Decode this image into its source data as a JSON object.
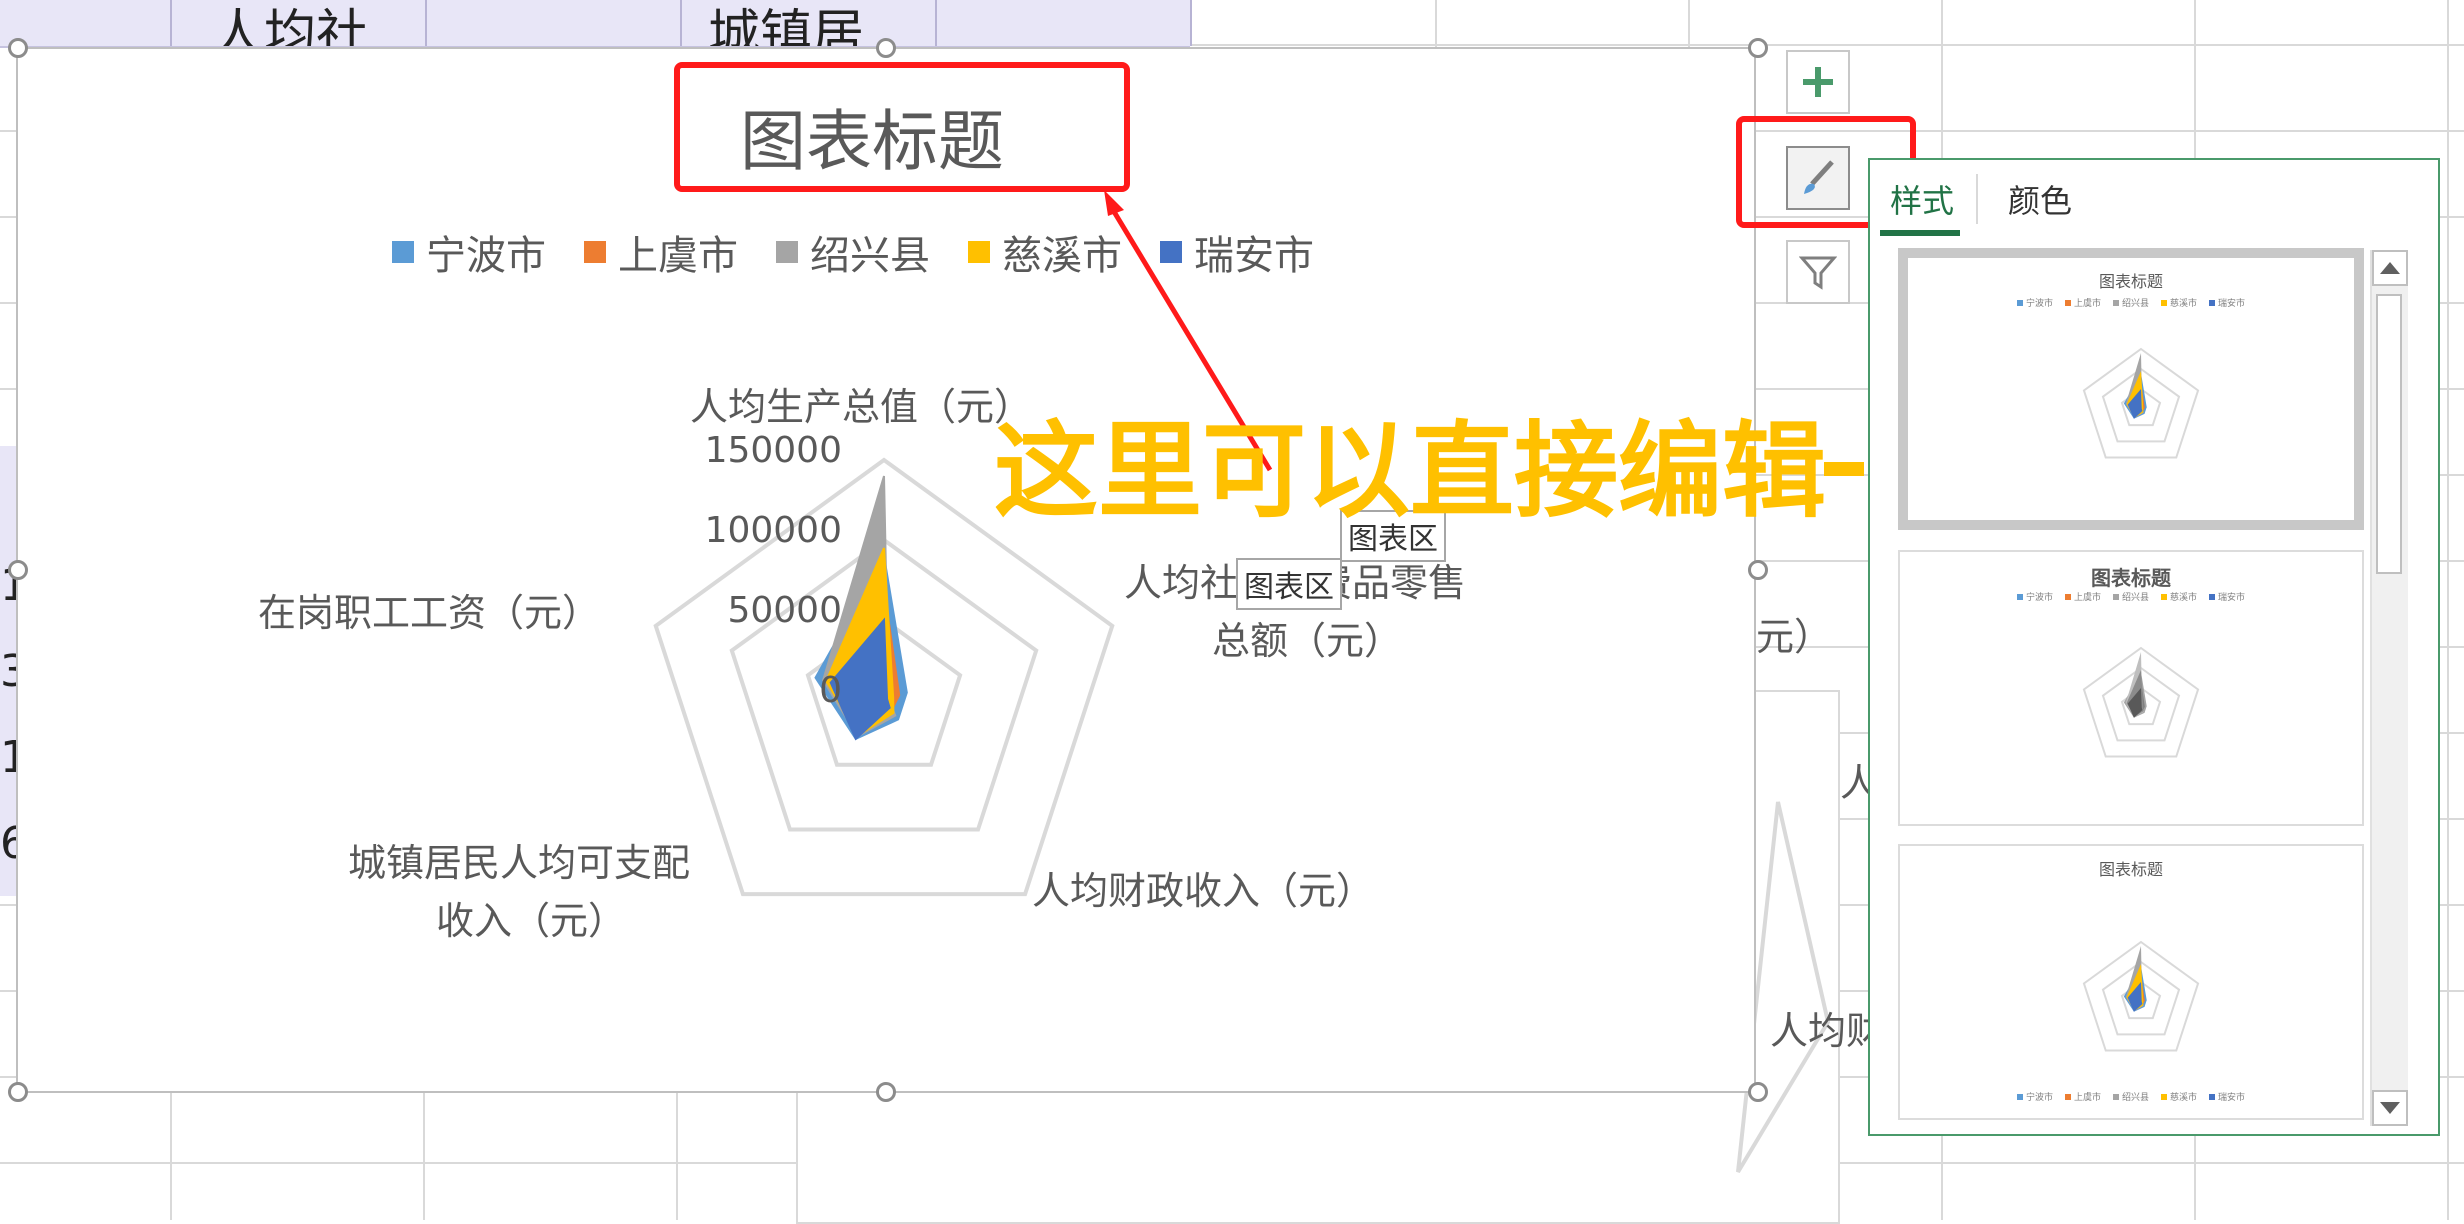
{
  "spreadsheet": {
    "header_cells": [
      "人均社",
      "",
      "城镇居",
      ""
    ],
    "left_column_chars": [
      "1",
      "3",
      "1",
      "6"
    ]
  },
  "ghost_chart": {
    "labels": [
      "元）",
      "人",
      "人均财"
    ]
  },
  "chart": {
    "title": "图表标题",
    "legend": [
      {
        "name": "宁波市",
        "color": "#5b9bd5"
      },
      {
        "name": "上虞市",
        "color": "#ed7d31"
      },
      {
        "name": "绍兴县",
        "color": "#a5a5a5"
      },
      {
        "name": "慈溪市",
        "color": "#ffc000"
      },
      {
        "name": "瑞安市",
        "color": "#4472c4"
      }
    ],
    "axis_labels": {
      "top": "人均生产总值（元）",
      "right_line1": "人均社会消费品零售",
      "right_line2": "总额（元）",
      "bottom_right": "人均财政收入（元）",
      "bottom_left_line1": "城镇居民人均可支配",
      "bottom_left_line2": "收入（元）",
      "left": "在岗职工工资（元）"
    },
    "ticks": [
      "150000",
      "100000",
      "50000",
      "0"
    ],
    "tooltips": [
      "图表区",
      "图表区"
    ]
  },
  "chart_data": {
    "type": "radar",
    "title": "图表标题",
    "categories": [
      "人均生产总值（元）",
      "人均社会消费品零售总额（元）",
      "人均财政收入（元）",
      "城镇居民人均可支配收入（元）",
      "在岗职工工资（元）"
    ],
    "rlim": [
      0,
      150000
    ],
    "ticks": [
      0,
      50000,
      100000,
      150000
    ],
    "series": [
      {
        "name": "宁波市",
        "color": "#5b9bd5",
        "values": [
          90000,
          15000,
          15000,
          30000,
          45000
        ]
      },
      {
        "name": "上虞市",
        "color": "#ed7d31",
        "values": [
          70000,
          10000,
          8000,
          25000,
          35000
        ]
      },
      {
        "name": "绍兴县",
        "color": "#a5a5a5",
        "values": [
          140000,
          3000,
          12000,
          28000,
          40000
        ]
      },
      {
        "name": "慈溪市",
        "color": "#ffc000",
        "values": [
          95000,
          6000,
          10000,
          27000,
          38000
        ]
      },
      {
        "name": "瑞安市",
        "color": "#4472c4",
        "values": [
          50000,
          2000,
          6000,
          30000,
          35000
        ]
      }
    ]
  },
  "annotation": {
    "text": "这里可以直接编辑"
  },
  "side_buttons": [
    {
      "name": "add-chart-element",
      "icon": "plus-icon"
    },
    {
      "name": "chart-styles",
      "icon": "brush-icon"
    },
    {
      "name": "chart-filter",
      "icon": "funnel-icon"
    }
  ],
  "styles_pane": {
    "tabs": [
      "样式",
      "颜色"
    ],
    "thumb_title": "图表标题",
    "thumb_legend": [
      "宁波市",
      "上虞市",
      "绍兴县",
      "慈溪市",
      "瑞安市"
    ]
  }
}
